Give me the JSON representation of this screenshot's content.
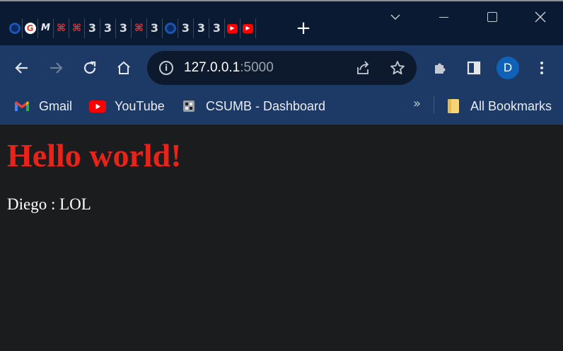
{
  "browser": {
    "tabs": [
      {
        "favicon": "chrome-icon"
      },
      {
        "favicon": "google-icon"
      },
      {
        "favicon": "m-icon"
      },
      {
        "favicon": "red-logo-icon"
      },
      {
        "favicon": "red-logo-icon"
      },
      {
        "favicon": "three-icon"
      },
      {
        "favicon": "three-icon"
      },
      {
        "favicon": "three-icon"
      },
      {
        "favicon": "red-logo-icon"
      },
      {
        "favicon": "three-icon"
      },
      {
        "favicon": "chrome-icon"
      },
      {
        "favicon": "three-icon"
      },
      {
        "favicon": "three-icon"
      },
      {
        "favicon": "three-icon"
      },
      {
        "favicon": "youtube-icon"
      },
      {
        "favicon": "youtube-icon"
      }
    ],
    "new_tab_glyph": "+",
    "address": {
      "host": "127.0.0.1",
      "port": ":5000"
    },
    "profile_initial": "D",
    "bookmarks": [
      {
        "label": "Gmail",
        "icon": "gmail-icon"
      },
      {
        "label": "YouTube",
        "icon": "youtube-icon"
      },
      {
        "label": "CSUMB - Dashboard",
        "icon": "csumb-icon"
      }
    ],
    "bookmarks_overflow": "»",
    "all_bookmarks_label": "All Bookmarks",
    "colors": {
      "tabstrip": "#0a1a33",
      "toolbar": "#1d3a66",
      "omnibox": "#0d1a2e",
      "avatar": "#1062b8"
    }
  },
  "page": {
    "heading": "Hello world!",
    "paragraph": "Diego : LOL",
    "colors": {
      "heading": "#e8231a",
      "text": "#ffffff",
      "background": "#1b1c1e"
    }
  }
}
